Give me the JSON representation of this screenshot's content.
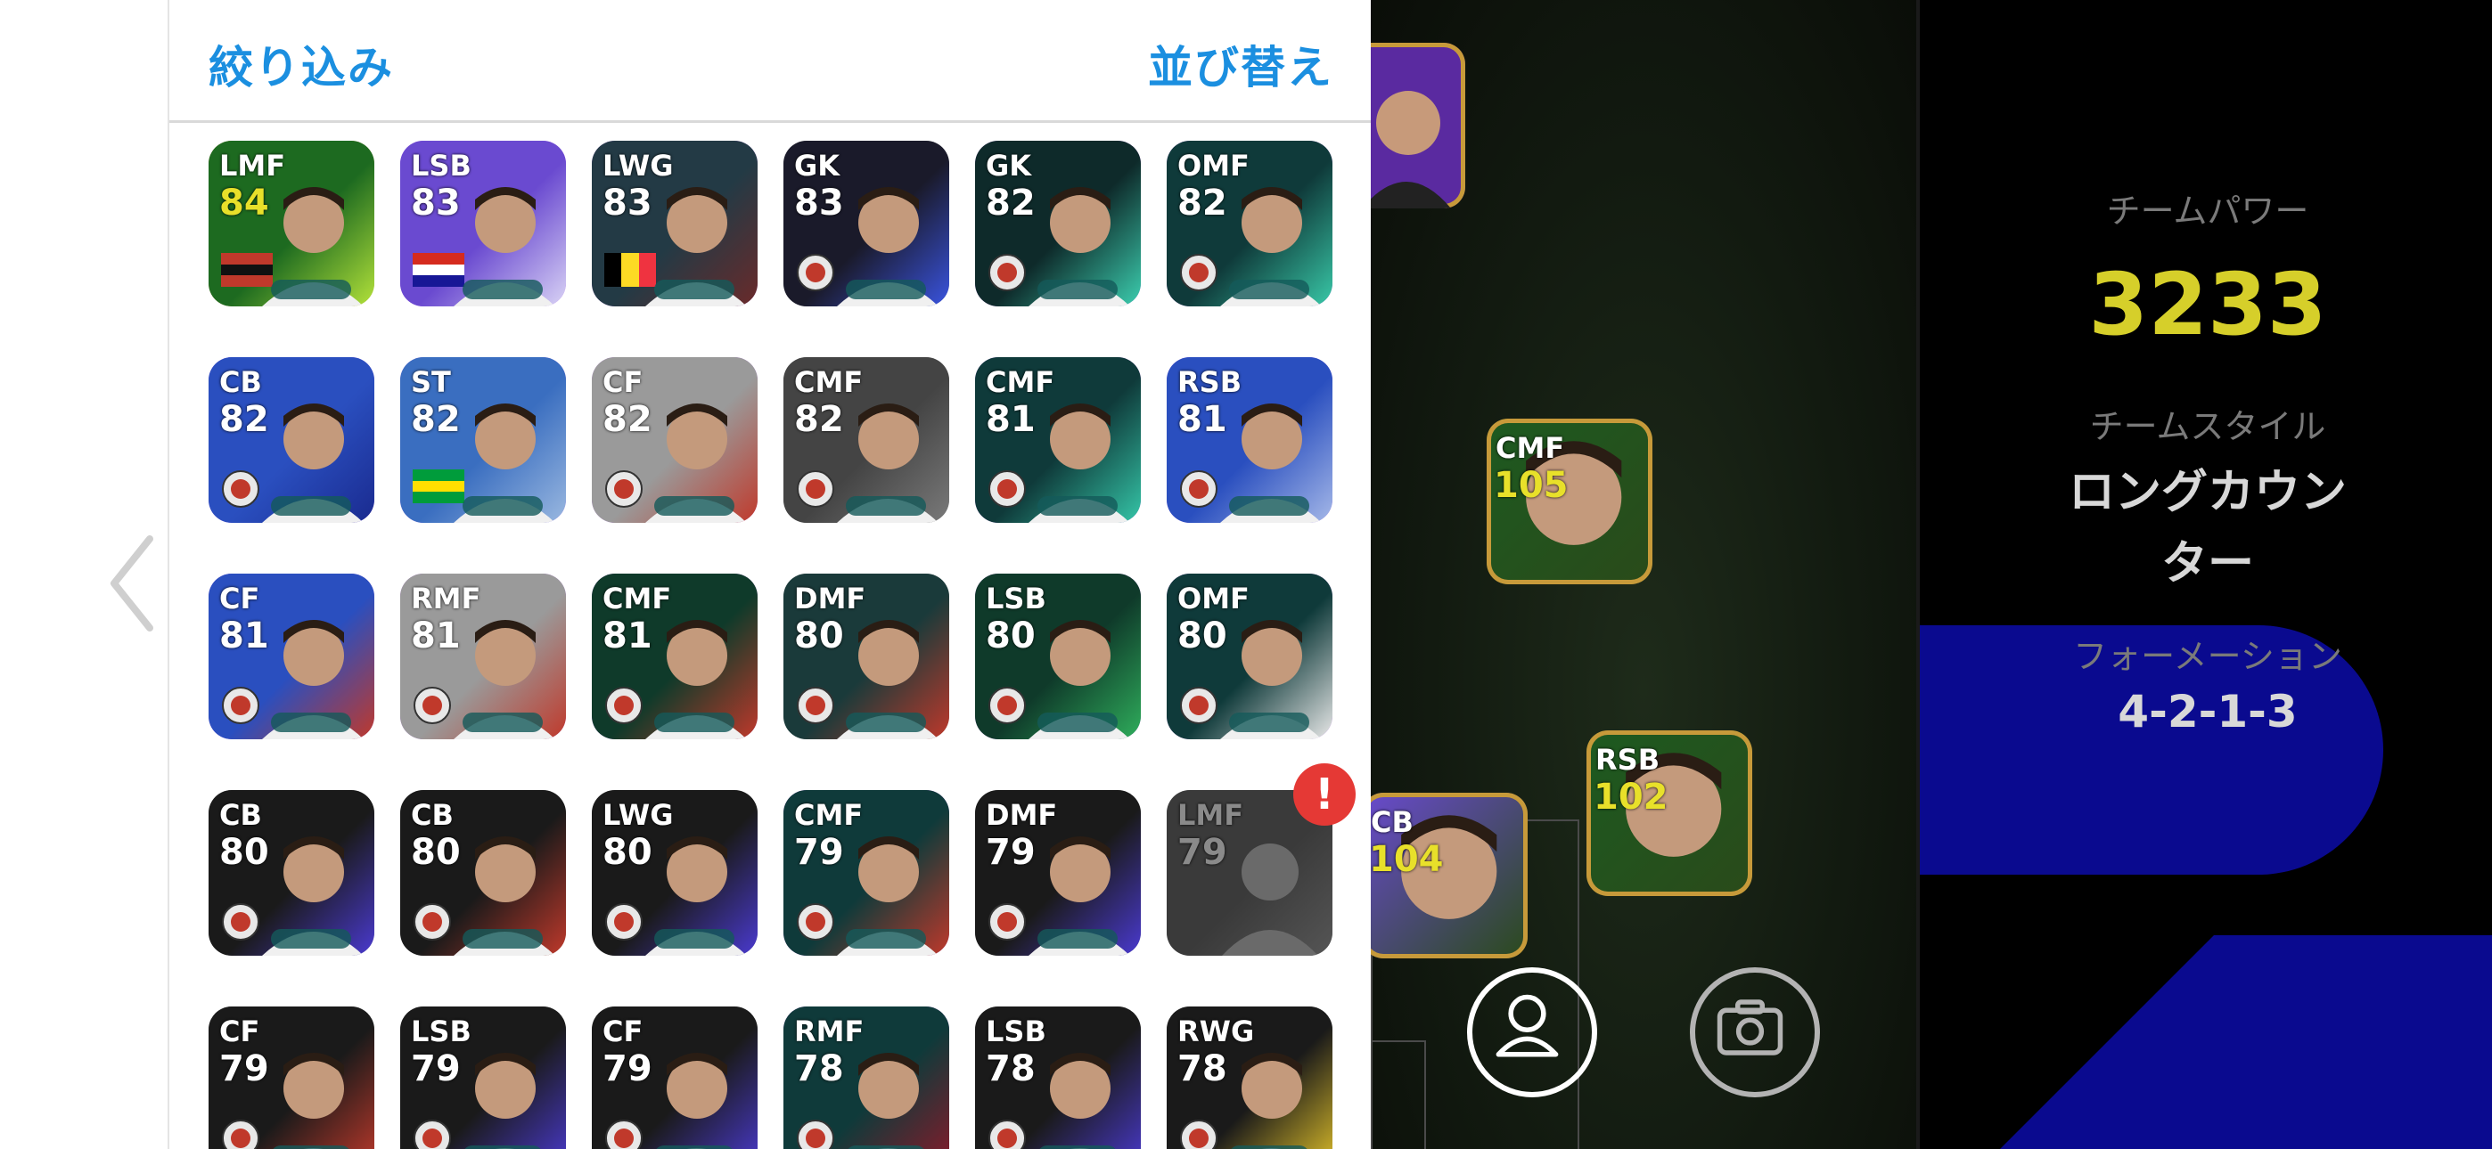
{
  "panel": {
    "filter_label": "絞り込み",
    "sort_label": "並び替え"
  },
  "players": [
    {
      "pos": "LMF",
      "ovr": "84",
      "gold": true,
      "frame": "gold",
      "bg": "#1d6a20",
      "accent": "#b3e23a",
      "mark": "flag-badge"
    },
    {
      "pos": "LSB",
      "ovr": "83",
      "gold": false,
      "frame": "purple",
      "bg": "#6a4ad0",
      "accent": "#d9d3f5",
      "mark": "flag-hr"
    },
    {
      "pos": "LWG",
      "ovr": "83",
      "gold": false,
      "frame": "purple",
      "bg": "#233a45",
      "accent": "#6a2a2a",
      "mark": "flag-be"
    },
    {
      "pos": "GK",
      "ovr": "83",
      "gold": false,
      "frame": "gray",
      "bg": "#1a1a2a",
      "accent": "#3a54e0",
      "mark": "badge-psg"
    },
    {
      "pos": "GK",
      "ovr": "82",
      "gold": false,
      "frame": "purple",
      "bg": "#0e2a2a",
      "accent": "#3ccfb0",
      "mark": "badge-club"
    },
    {
      "pos": "OMF",
      "ovr": "82",
      "gold": false,
      "frame": "purple",
      "bg": "#0f3a3a",
      "accent": "#39c9a8",
      "mark": "badge-club"
    },
    {
      "pos": "CB",
      "ovr": "82",
      "gold": false,
      "frame": "purple",
      "bg": "#2a4fbf",
      "accent": "#1a2a8f",
      "mark": "badge-club"
    },
    {
      "pos": "ST",
      "ovr": "82",
      "gold": false,
      "frame": "purple",
      "bg": "#3a6ec0",
      "accent": "#9ab8e0",
      "mark": "flag-br"
    },
    {
      "pos": "CF",
      "ovr": "82",
      "gold": false,
      "frame": "purple",
      "bg": "#9a9a9a",
      "accent": "#c0392b",
      "mark": "badge-club"
    },
    {
      "pos": "CMF",
      "ovr": "82",
      "gold": false,
      "frame": "gray",
      "bg": "#444",
      "accent": "#7a7a7a",
      "mark": "badge-club"
    },
    {
      "pos": "CMF",
      "ovr": "81",
      "gold": false,
      "frame": "purple",
      "bg": "#0f3a3a",
      "accent": "#35c6a8",
      "mark": "badge-club"
    },
    {
      "pos": "RSB",
      "ovr": "81",
      "gold": false,
      "frame": "purple",
      "bg": "#2a4fbf",
      "accent": "#a5b8e8",
      "mark": "badge-club"
    },
    {
      "pos": "CF",
      "ovr": "81",
      "gold": false,
      "frame": "purple",
      "bg": "#2a4fbf",
      "accent": "#c0392b",
      "mark": "badge-club"
    },
    {
      "pos": "RMF",
      "ovr": "81",
      "gold": false,
      "frame": "purple",
      "bg": "#9a9a9a",
      "accent": "#c0392b",
      "mark": "badge-club"
    },
    {
      "pos": "CMF",
      "ovr": "81",
      "gold": false,
      "frame": "purple",
      "bg": "#0f3a2a",
      "accent": "#c0392b",
      "mark": "badge-club"
    },
    {
      "pos": "DMF",
      "ovr": "80",
      "gold": false,
      "frame": "gray",
      "bg": "#1a3a3a",
      "accent": "#c0392b",
      "mark": "badge-club"
    },
    {
      "pos": "LSB",
      "ovr": "80",
      "gold": false,
      "frame": "purple",
      "bg": "#0f3a2a",
      "accent": "#2fae5c",
      "mark": "badge-club"
    },
    {
      "pos": "OMF",
      "ovr": "80",
      "gold": false,
      "frame": "purple",
      "bg": "#0f3a3a",
      "accent": "#e8e8e8",
      "mark": "badge-club"
    },
    {
      "pos": "CB",
      "ovr": "80",
      "gold": false,
      "frame": "gray",
      "bg": "#1a1a1a",
      "accent": "#4a3ad0",
      "mark": "badge-club"
    },
    {
      "pos": "CB",
      "ovr": "80",
      "gold": false,
      "frame": "gray",
      "bg": "#1a1a1a",
      "accent": "#c0392b",
      "mark": "badge-club"
    },
    {
      "pos": "LWG",
      "ovr": "80",
      "gold": false,
      "frame": "gray",
      "bg": "#1a1a1a",
      "accent": "#4a3ad0",
      "mark": "badge-club"
    },
    {
      "pos": "CMF",
      "ovr": "79",
      "gold": false,
      "frame": "purple",
      "bg": "#0f3a3a",
      "accent": "#c0392b",
      "mark": "badge-club"
    },
    {
      "pos": "DMF",
      "ovr": "79",
      "gold": false,
      "frame": "gray",
      "bg": "#1a1a1a",
      "accent": "#4a3ad0",
      "mark": "badge-club"
    },
    {
      "pos": "LMF",
      "ovr": "79",
      "gold": false,
      "frame": "gray",
      "bg": "#3a3a3a",
      "accent": "#555",
      "mark": "none",
      "placeholder": true
    },
    {
      "pos": "CF",
      "ovr": "79",
      "gold": false,
      "frame": "gray",
      "bg": "#1a1a1a",
      "accent": "#c0392b",
      "mark": "badge-club"
    },
    {
      "pos": "LSB",
      "ovr": "79",
      "gold": false,
      "frame": "gray",
      "bg": "#1a1a1a",
      "accent": "#4a3ad0",
      "mark": "badge-club"
    },
    {
      "pos": "CF",
      "ovr": "79",
      "gold": false,
      "frame": "gray",
      "bg": "#1a1a1a",
      "accent": "#4a3ad0",
      "mark": "badge-club"
    },
    {
      "pos": "RMF",
      "ovr": "78",
      "gold": false,
      "frame": "purple",
      "bg": "#0f3a3a",
      "accent": "#8a1a2a",
      "mark": "badge-club"
    },
    {
      "pos": "LSB",
      "ovr": "78",
      "gold": false,
      "frame": "gray",
      "bg": "#1a1a1a",
      "accent": "#4a3ad0",
      "mark": "badge-club"
    },
    {
      "pos": "RWG",
      "ovr": "78",
      "gold": false,
      "frame": "gray",
      "bg": "#1a1a1a",
      "accent": "#e0c02a",
      "mark": "badge-club"
    }
  ],
  "alert_text": "!",
  "pitch": {
    "cards": [
      {
        "pos": "CMF",
        "ovr": "105",
        "bg": "#1d5a20",
        "mark": "flag-de"
      },
      {
        "pos": "RSB",
        "ovr": "102",
        "bg": "#1d5a20",
        "mark": "badge-club"
      },
      {
        "pos": "CB",
        "ovr": "104",
        "bg": "#6a4ad0",
        "mark": "badge-club"
      }
    ]
  },
  "team": {
    "power_label": "チームパワー",
    "power_value": "3233",
    "style_label": "チームスタイル",
    "style_value_line1": "ロングカウン",
    "style_value_line2": "ター",
    "formation_label": "フォーメーション",
    "formation_value": "4-2-1-3"
  },
  "colors": {
    "accent_blue": "#1b8fe0",
    "power_yellow": "#d6cf2a",
    "alert_red": "#e53935"
  }
}
